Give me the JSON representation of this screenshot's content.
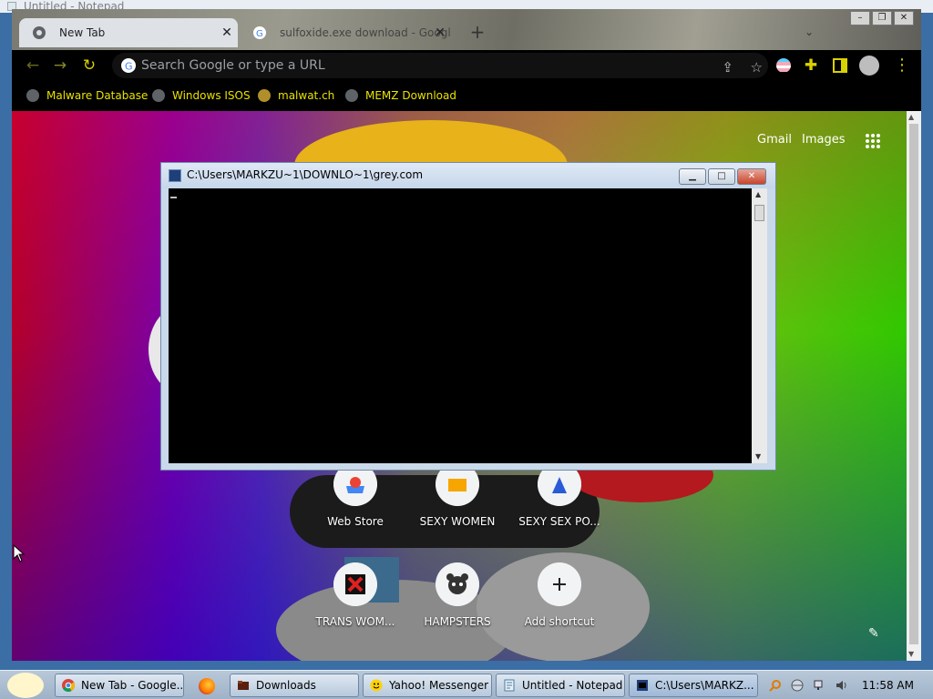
{
  "notepad": {
    "title": "Untitled - Notepad"
  },
  "browser": {
    "tabs": [
      {
        "label": "New Tab",
        "active": true
      },
      {
        "label": "sulfoxide.exe download - Googl",
        "active": false
      }
    ],
    "omnibox": {
      "placeholder": "Search Google or type a URL"
    },
    "bookmarks": [
      "Malware Database",
      "Windows ISOS",
      "malwat.ch",
      "MEMZ Download"
    ],
    "ntp": {
      "gmail": "Gmail",
      "images": "Images",
      "shortcuts": [
        {
          "label": "Web Store",
          "icon": "chrome-web-store-icon"
        },
        {
          "label": "SEXY WOMEN",
          "icon": "site-icon"
        },
        {
          "label": "SEXY SEX PO...",
          "icon": "site-icon"
        },
        {
          "label": "TRANS WOM...",
          "icon": "x-icon"
        },
        {
          "label": "HAMPSTERS",
          "icon": "hamster-icon"
        },
        {
          "label": "Add shortcut",
          "icon": "plus-icon"
        }
      ]
    }
  },
  "console": {
    "title": "C:\\Users\\MARKZU~1\\DOWNLO~1\\grey.com"
  },
  "taskbar": {
    "items": [
      {
        "label": "New Tab - Google...",
        "icon": "chrome-icon"
      },
      {
        "label": "Downloads",
        "icon": "folder-icon"
      },
      {
        "label": "Yahoo! Messenger",
        "icon": "yahoo-icon"
      },
      {
        "label": "Untitled - Notepad",
        "icon": "notepad-icon"
      },
      {
        "label": "C:\\Users\\MARKZ...",
        "icon": "console-icon"
      }
    ],
    "clock": "11:58 AM"
  },
  "colors": {
    "accent": "#d9d100",
    "bookmark_text": "#e9e100",
    "close_red": "#c8442b"
  }
}
